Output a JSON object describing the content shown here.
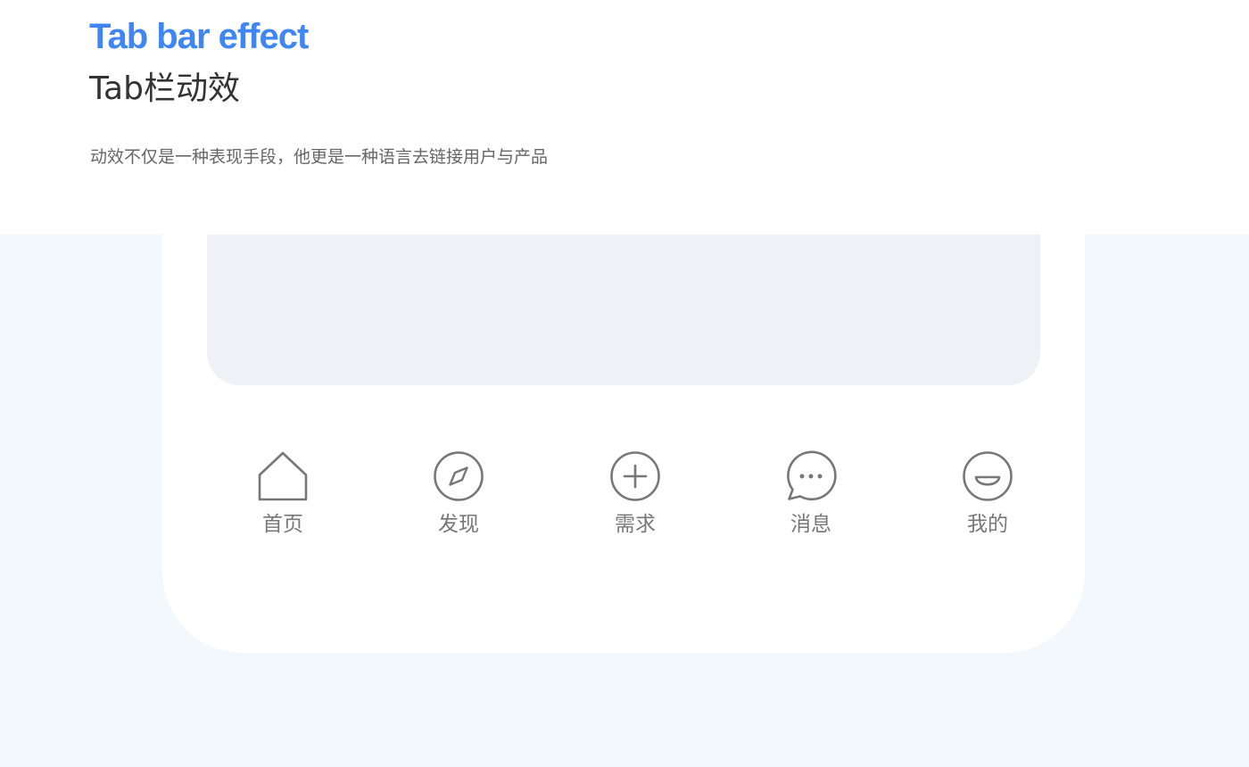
{
  "header": {
    "title_en": "Tab bar effect",
    "title_cn": "Tab栏动效",
    "subtitle": "动效不仅是一种表现手段，他更是一种语言去链接用户与产品"
  },
  "colors": {
    "accent": "#3f86f4",
    "page_background": "#f3f8fd",
    "phone_background": "#ffffff",
    "content_panel": "#eef2f6",
    "tab_icon": "#777777",
    "tab_label": "#777777"
  },
  "tabbar": {
    "items": [
      {
        "label": "首页",
        "icon": "home-icon"
      },
      {
        "label": "发现",
        "icon": "compass-icon"
      },
      {
        "label": "需求",
        "icon": "plus-circle-icon"
      },
      {
        "label": "消息",
        "icon": "chat-bubble-icon"
      },
      {
        "label": "我的",
        "icon": "smile-face-icon"
      }
    ]
  }
}
